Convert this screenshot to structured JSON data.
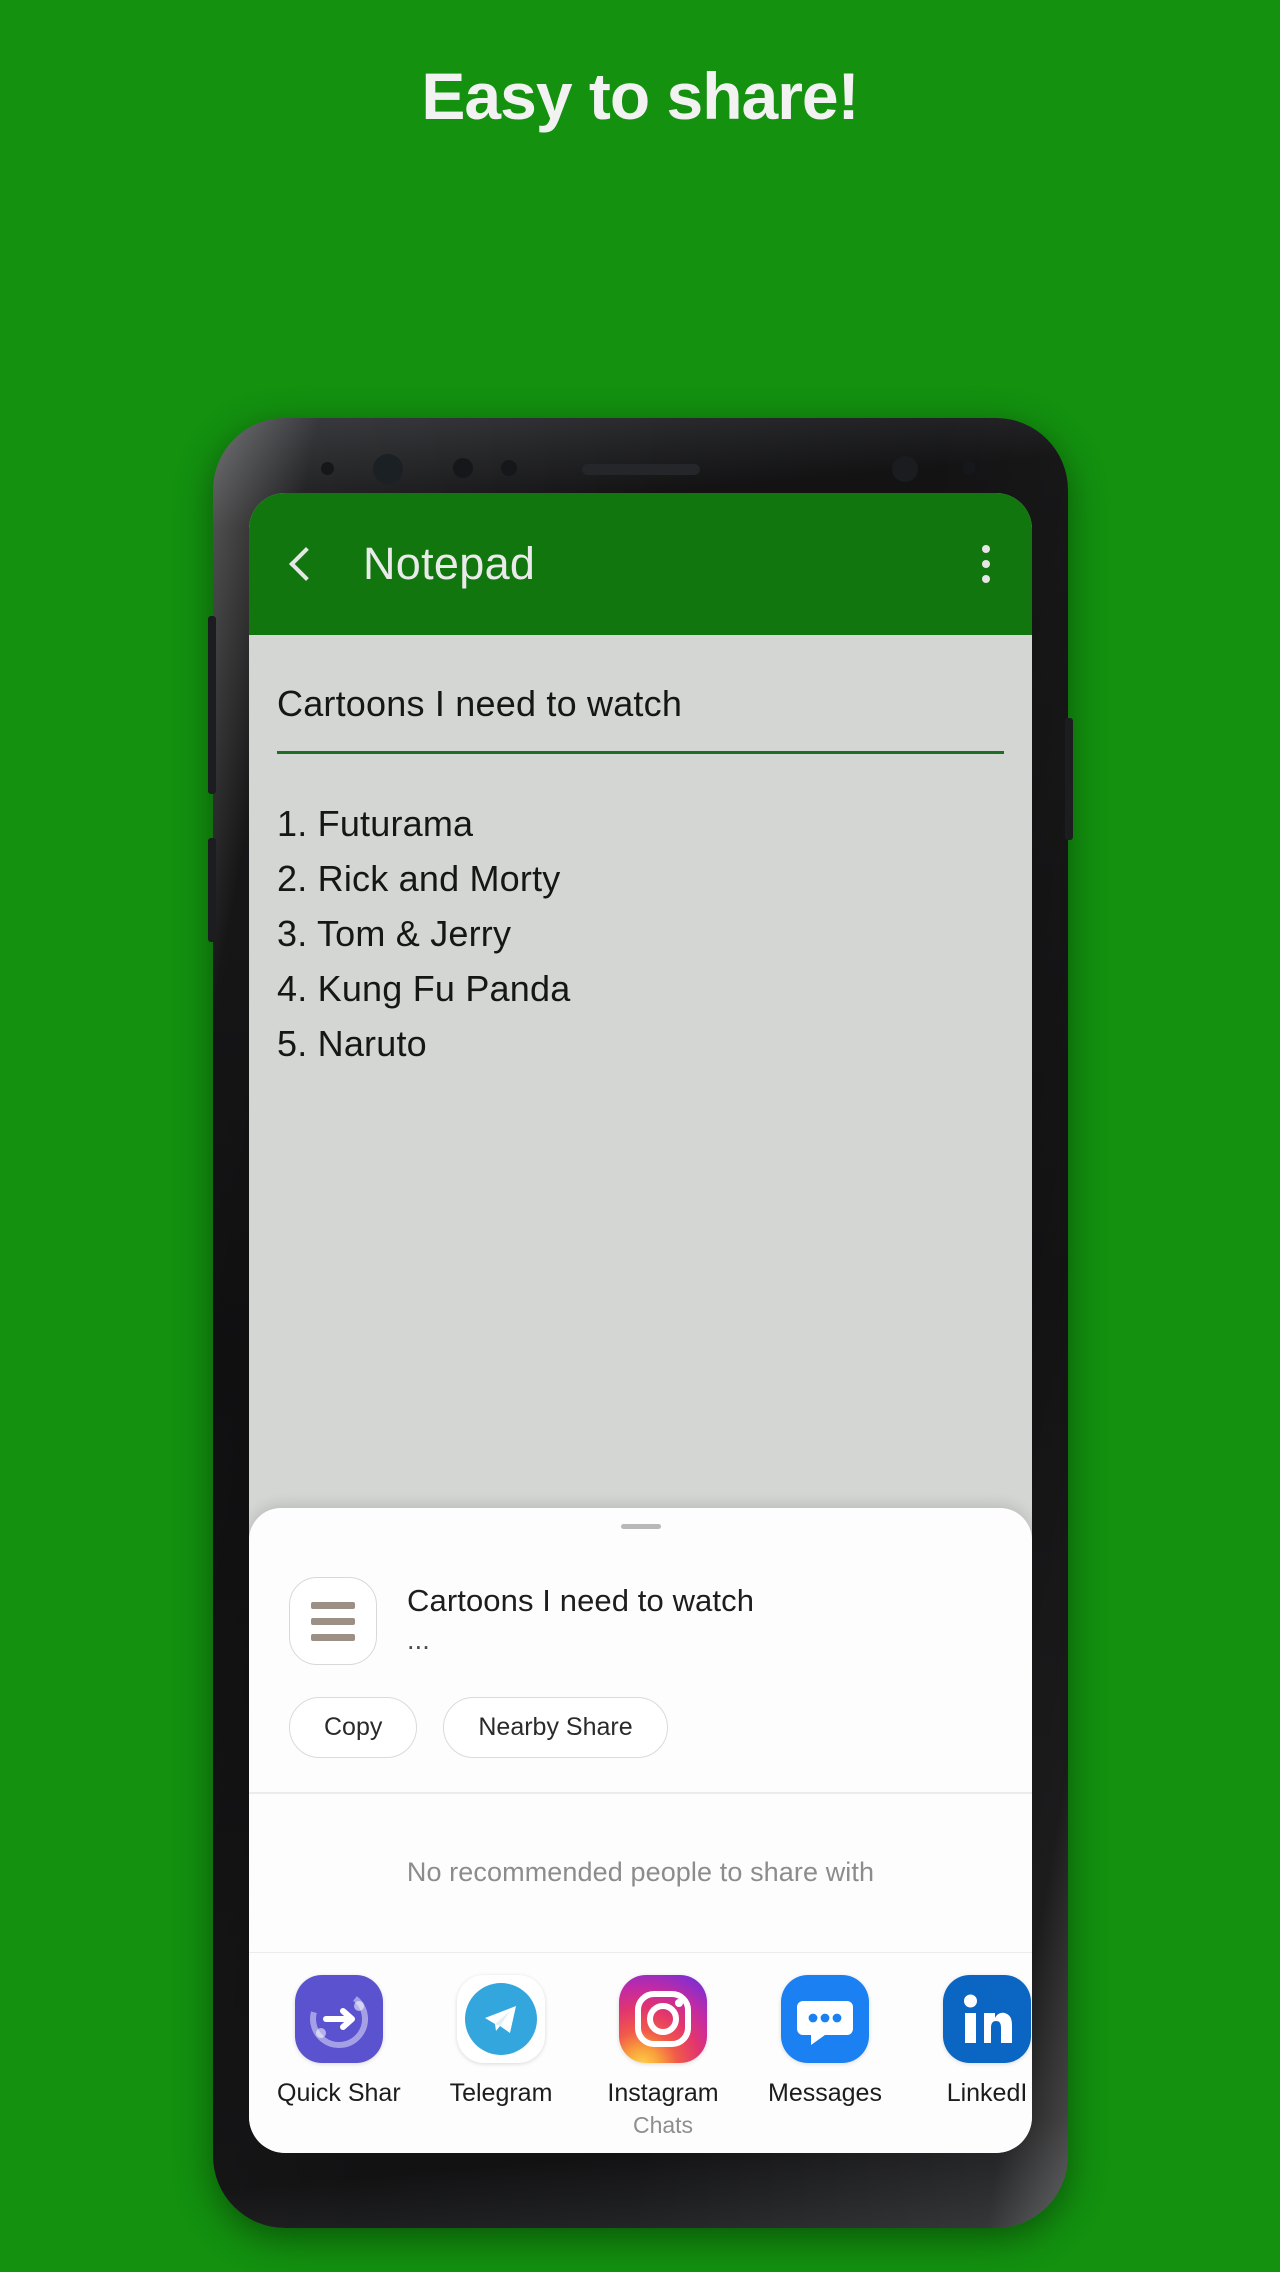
{
  "promo": {
    "headline": "Easy to share!",
    "background_color": "#13910f"
  },
  "app": {
    "appbar": {
      "back_icon": "chevron-left-icon",
      "title": "Notepad",
      "overflow_icon": "more-vertical-icon",
      "color": "#12760f"
    },
    "note": {
      "title": "Cartoons I need to watch",
      "items": [
        "1. Futurama",
        "2. Rick and Morty",
        "3. Tom & Jerry",
        "4. Kung Fu Panda",
        "5. Naruto"
      ],
      "background_color": "#d3d6d3"
    }
  },
  "share_sheet": {
    "preview": {
      "icon": "text-lines-icon",
      "title": "Cartoons I need to watch",
      "subtitle": "..."
    },
    "chips": [
      {
        "label": "Copy"
      },
      {
        "label": "Nearby Share"
      }
    ],
    "empty_state": "No recommended people to share with",
    "apps": [
      {
        "label": "Quick Share",
        "icon": "quick-share-icon",
        "sub": ""
      },
      {
        "label": "Telegram",
        "icon": "telegram-icon",
        "sub": ""
      },
      {
        "label": "Instagram",
        "icon": "instagram-icon",
        "sub": "Chats"
      },
      {
        "label": "Messages",
        "icon": "messages-icon",
        "sub": ""
      },
      {
        "label": "LinkedI",
        "icon": "linkedin-icon",
        "sub": ""
      }
    ]
  }
}
